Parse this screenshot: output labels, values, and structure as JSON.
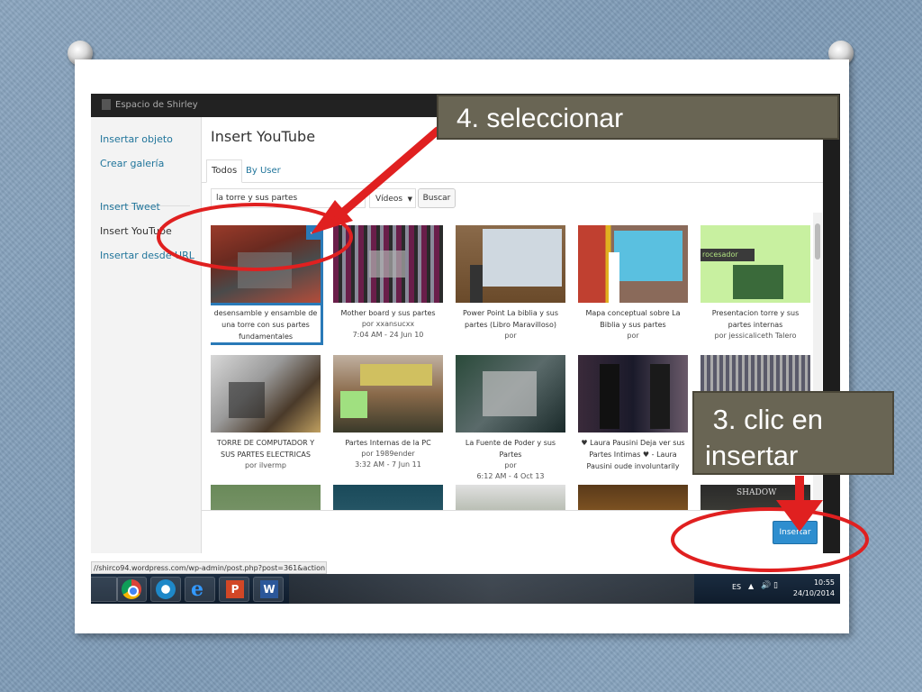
{
  "topbar": {
    "site_title": "Espacio de Shirley"
  },
  "sidebar": {
    "items": [
      {
        "label": "Insertar objeto"
      },
      {
        "label": "Crear galería"
      },
      {
        "label": "Insert Tweet"
      },
      {
        "label": "Insert YouTube"
      },
      {
        "label": "Insertar desde URL"
      }
    ]
  },
  "modal": {
    "title": "Insert YouTube",
    "tabs": [
      {
        "label": "Todos"
      },
      {
        "label": "By User"
      }
    ],
    "search_value": "la torre y sus partes",
    "select_value": "Vídeos",
    "search_button": "Buscar",
    "insert_button": "Insertar"
  },
  "videos": [
    {
      "title": "desensamble y ensamble de una torre con sus partes fundamentales",
      "meta": ""
    },
    {
      "title": "Mother board y sus partes",
      "meta": "por xxansucxx",
      "meta2": "7:04 AM - 24 Jun 10"
    },
    {
      "title": "Power Point La biblia y sus partes (Libro Maravilloso)",
      "meta": "por"
    },
    {
      "title": "Mapa conceptual sobre La Biblia y sus partes",
      "meta": "por"
    },
    {
      "title": "Presentacion torre y sus partes internas",
      "meta": "por jessicaliceth Talero"
    },
    {
      "title": "TORRE DE COMPUTADOR Y SUS PARTES ELECTRICAS",
      "meta": "por ilvermp"
    },
    {
      "title": "Partes Internas de la PC",
      "meta": "por 1989ender",
      "meta2": "3:32 AM - 7 Jun 11"
    },
    {
      "title": "La Fuente de Poder y sus Partes",
      "meta": "por",
      "meta2": "6:12 AM - 4 Oct 13"
    },
    {
      "title": "♥ Laura Pausini Deja ver sus Partes Intimas ♥ - Laura Pausini oude involuntarily",
      "meta": ""
    }
  ],
  "thumb_text": {
    "procesador": "rocesador",
    "shadow": "SHADOW"
  },
  "status_url": "//shirco94.wordpress.com/wp-admin/post.php?post=361&action=edit#",
  "tray": {
    "lang": "ES",
    "time": "10:55",
    "date": "24/10/2014"
  },
  "callouts": {
    "step4": "4. seleccionar",
    "step3_line1": " 3. clic en",
    "step3_line2": "insertar"
  },
  "colors": {
    "accent": "#2e8ecf",
    "callout": "#696554",
    "annotation": "#e02020"
  }
}
